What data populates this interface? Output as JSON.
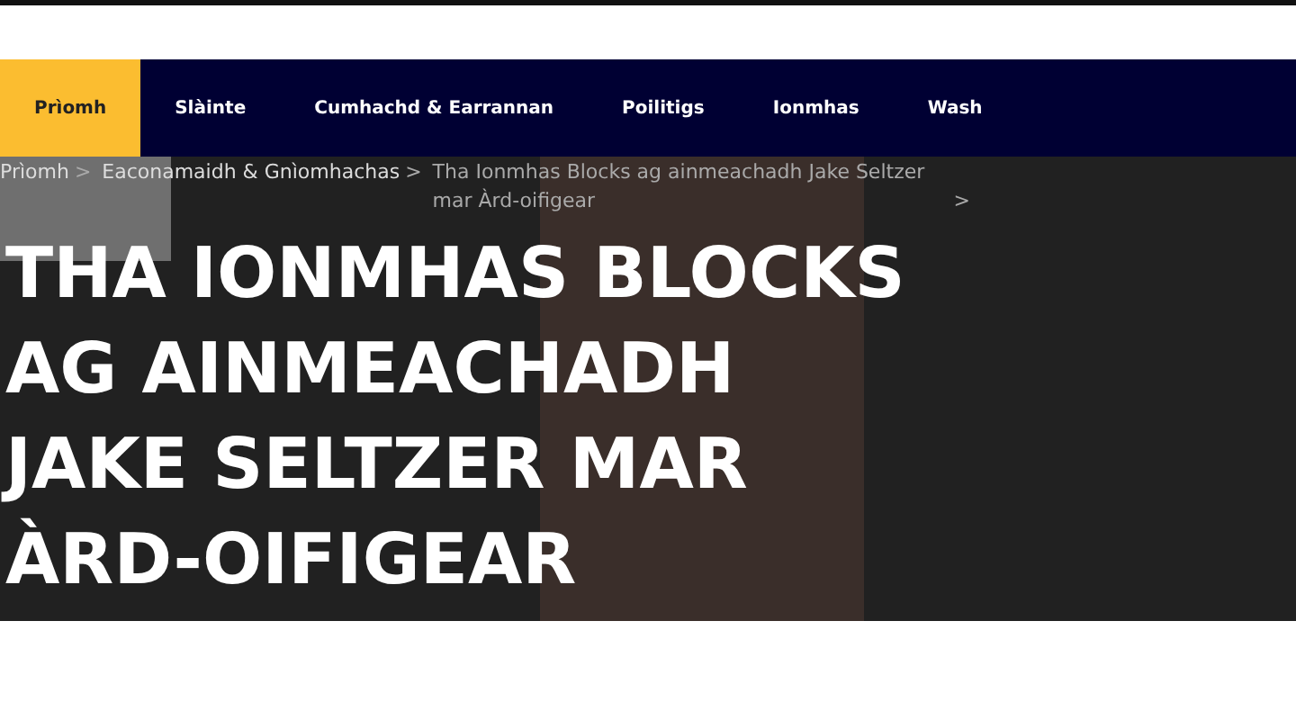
{
  "nav": {
    "items": [
      {
        "label": "Prìomh",
        "selected": true
      },
      {
        "label": "Slàinte",
        "selected": false
      },
      {
        "label": "Cumhachd & Earrannan",
        "selected": false
      },
      {
        "label": "Poilitigs",
        "selected": false
      },
      {
        "label": "Ionmhas",
        "selected": false
      },
      {
        "label": "Wash",
        "selected": false
      }
    ]
  },
  "breadcrumb": {
    "separator": ">",
    "items": [
      "Prìomh",
      "Eaconamaidh & Gnìomhachas",
      "Tha Ionmhas Blocks ag ainmeachadh Jake Seltzer mar Àrd-oifigear"
    ]
  },
  "article": {
    "title": "THA IONMHAS BLOCKS AG AINMEACHADH JAKE SELTZER MAR ÀRD-OIFIGEAR"
  }
}
